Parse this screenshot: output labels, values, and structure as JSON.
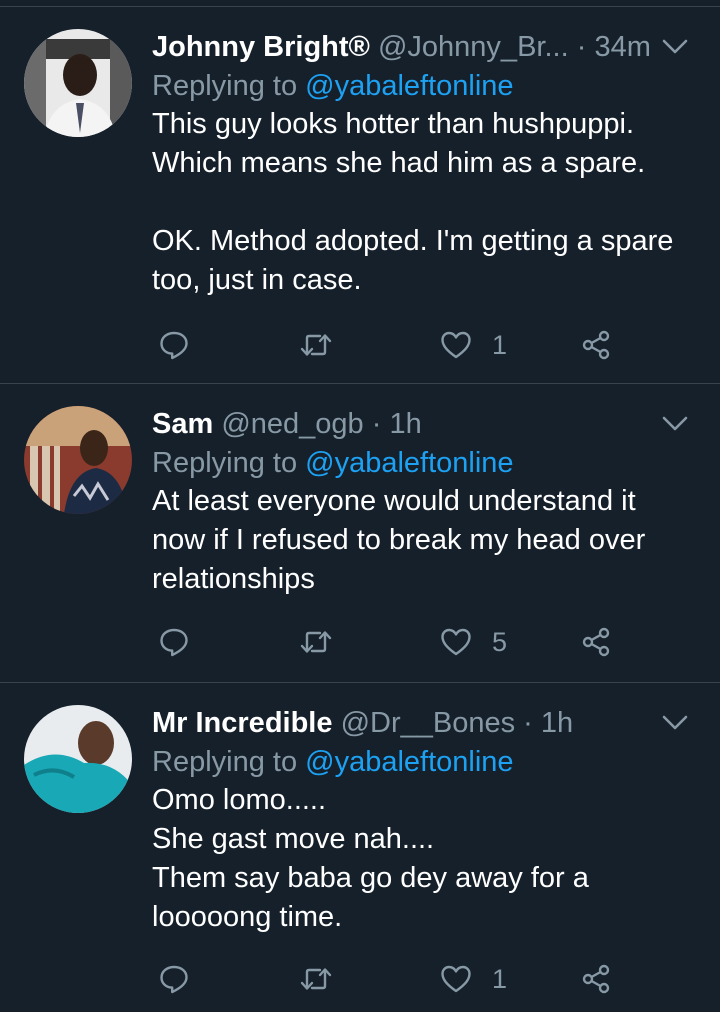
{
  "colors": {
    "background": "#15202b",
    "divider": "#38444d",
    "primary_text": "#ffffff",
    "secondary_text": "#8899a6",
    "link": "#1da1f2"
  },
  "icons": {
    "reply": "reply-icon",
    "retweet": "retweet-icon",
    "like": "heart-icon",
    "share": "share-icon",
    "menu": "chevron-down-icon"
  },
  "tweets": [
    {
      "display_name": "Johnny Bright®",
      "handle": "@Johnny_Br...",
      "separator": "·",
      "time": "34m",
      "replying_prefix": "Replying to",
      "replying_to": "@yabaleftonline",
      "body": [
        "This guy looks hotter than hushpuppi.",
        "Which means she had him as a spare.",
        "",
        "OK. Method adopted. I'm getting a spare",
        "too, just in case."
      ],
      "like_count": "1"
    },
    {
      "display_name": "Sam",
      "handle": "@ned_ogb",
      "separator": "·",
      "time": "1h",
      "replying_prefix": "Replying to",
      "replying_to": "@yabaleftonline",
      "body": [
        "At least everyone would understand it",
        "now if I refused to break my head over",
        "relationships"
      ],
      "like_count": "5"
    },
    {
      "display_name": "Mr Incredible",
      "handle": "@Dr__Bones",
      "separator": "·",
      "time": "1h",
      "replying_prefix": "Replying to",
      "replying_to": "@yabaleftonline",
      "body": [
        "Omo lomo.....",
        "She gast move nah....",
        "Them say baba go dey away for a",
        "looooong time."
      ],
      "like_count": "1"
    }
  ]
}
